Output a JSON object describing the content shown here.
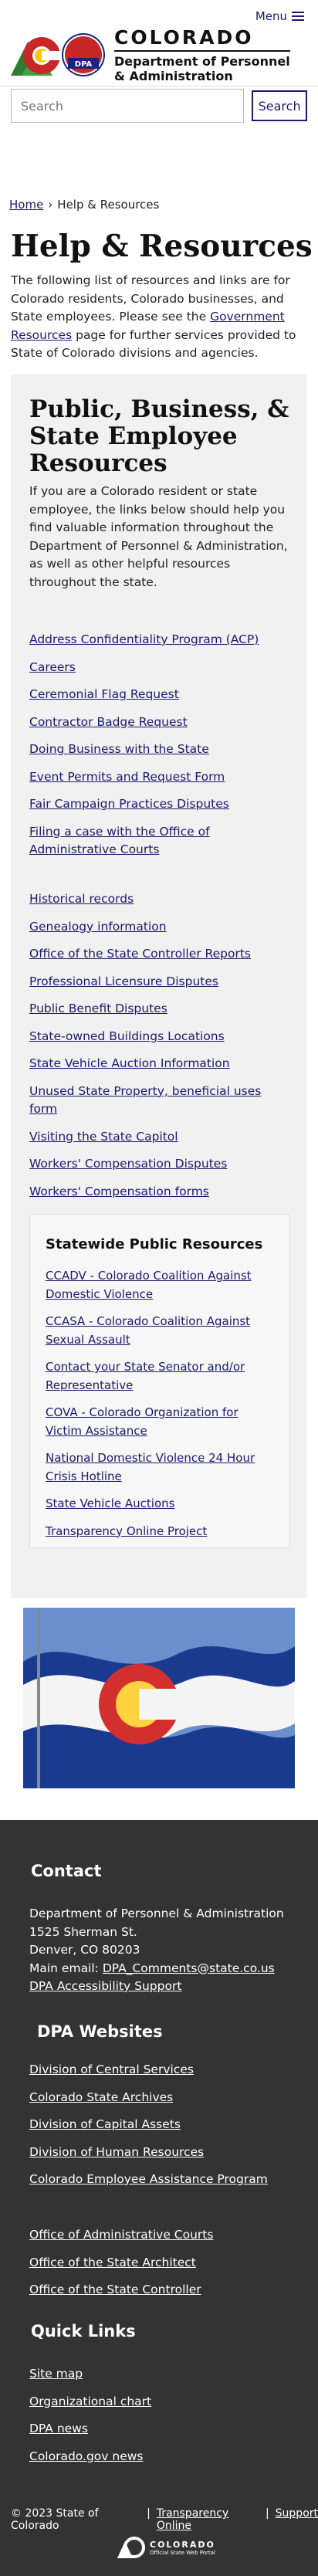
{
  "header": {
    "menu_label": "Menu",
    "brand_title": "COLORADO",
    "brand_sub_line1": "Department of Personnel",
    "brand_sub_line2": "& Administration",
    "dpa_badge": "DPA"
  },
  "search": {
    "placeholder": "Search",
    "button_label": "Search"
  },
  "breadcrumb": {
    "home": "Home",
    "separator": "›",
    "current": "Help & Resources"
  },
  "page": {
    "title": "Help & Resources",
    "intro_before": "The following list of resources and links are for Colorado residents, Colorado businesses, and State employees. Please see the ",
    "intro_link": "Government Resources",
    "intro_after": " page for further services provided to State of Colorado divisions and agencies."
  },
  "public": {
    "title": "Public, Business, & State Employee Resources",
    "description": "If you are a Colorado resident or state employee, the links below should help you find valuable information throughout the Department of Personnel & Administration, as well as other helpful resources throughout the state.",
    "links_group1": [
      "Address Confidentiality Program (ACP)",
      "Careers",
      "Ceremonial Flag Request",
      "Contractor Badge Request",
      "Doing Business with the State",
      "Event Permits and Request Form",
      "Fair Campaign Practices Disputes",
      "Filing a case with the Office of Administrative Courts"
    ],
    "links_group2": [
      "Historical records",
      "Genealogy information",
      "Office of the State Controller Reports",
      "Professional Licensure Disputes",
      "Public Benefit Disputes",
      "State-owned Buildings Locations",
      "State Vehicle Auction Information",
      "Unused State Property, beneficial uses form",
      "Visiting the State Capitol",
      "Workers' Compensation Disputes",
      "Workers' Compensation forms"
    ]
  },
  "statewide": {
    "title": "Statewide Public Resources",
    "links": [
      "CCADV - Colorado Coalition Against Domestic Violence",
      "CCASA - Colorado Coalition Against Sexual Assault",
      "Contact your State Senator and/or Representative",
      "COVA - Colorado Organization for Victim Assistance",
      "National Domestic Violence 24 Hour Crisis Hotline",
      "State Vehicle Auctions",
      "Transparency Online Project"
    ]
  },
  "footer": {
    "contact_heading": "Contact",
    "contact_line1": "Department of Personnel & Administration",
    "contact_line2": "1525 Sherman St.",
    "contact_line3": "Denver, CO 80203",
    "email_label": "Main email: ",
    "email": "DPA_Comments@state.co.us",
    "accessibility": "DPA Accessibility Support",
    "websites_heading": "DPA Websites",
    "websites_group1": [
      "Division of Central Services",
      "Colorado State Archives",
      "Division of Capital Assets",
      "Division of Human Resources",
      "Colorado Employee Assistance Program"
    ],
    "websites_group2": [
      "Office of Administrative Courts",
      "Office of the State Architect",
      "Office of the State Controller"
    ],
    "quick_heading": "Quick Links",
    "quick_links": [
      "Site map",
      "Organizational chart",
      "DPA news",
      "Colorado.gov news"
    ],
    "copyright": "© 2023 State of Colorado",
    "sep": "|",
    "transparency": "Transparency Online",
    "support": "Support",
    "portal_title": "COLORADO",
    "portal_sub": "Official State Web Portal"
  },
  "colors": {
    "link": "#1a1a6e",
    "footer_bg": "#333333",
    "box_bg": "#f1f1f1"
  },
  "icons": [
    "menu-icon",
    "colorado-logo-icon",
    "dpa-logo-icon",
    "colorado-flag-image",
    "colorado-portal-logo-icon"
  ]
}
